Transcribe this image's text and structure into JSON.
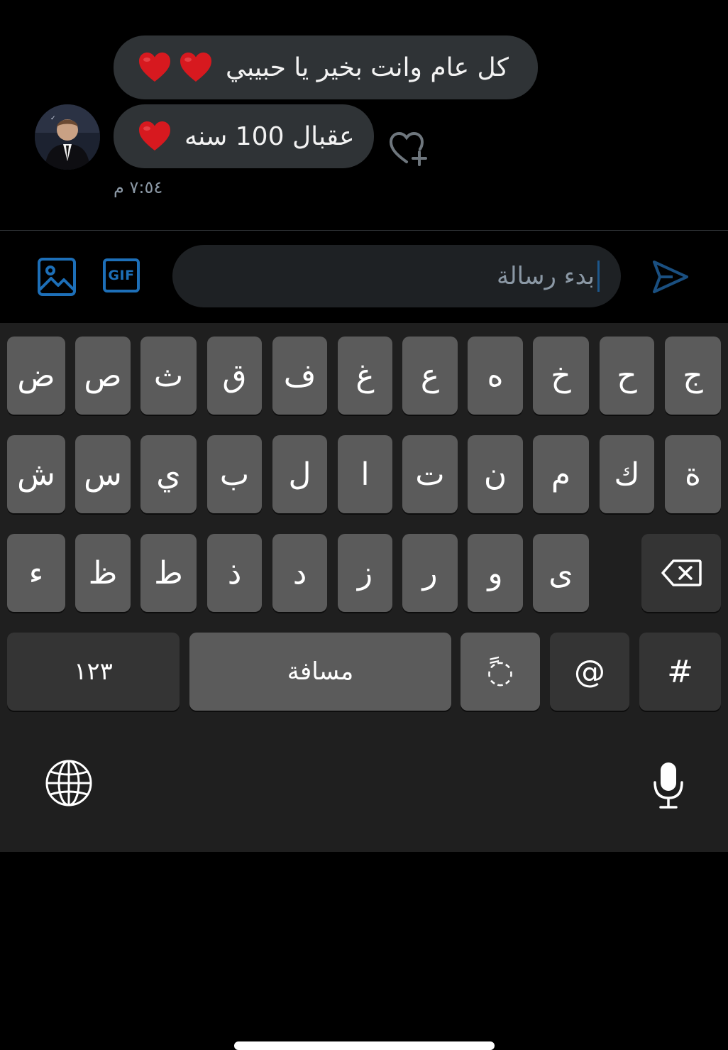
{
  "conversation": {
    "messages": [
      {
        "text": "كل عام وانت بخير يا حبيبي",
        "emoji": [
          "❤️",
          "❤️"
        ]
      },
      {
        "text": "عقبال 100 سنه",
        "emoji": [
          "❤️"
        ]
      }
    ],
    "timestamp": "٧:٥٤ م",
    "react_icon": "heart-plus-icon",
    "avatar": "avatar"
  },
  "composer": {
    "placeholder": "بدء رسالة",
    "image_icon": "image-icon",
    "gif_label": "GIF",
    "send_icon": "send-icon",
    "accent": "#1d6fb8"
  },
  "keyboard": {
    "row1": [
      "ض",
      "ص",
      "ث",
      "ق",
      "ف",
      "غ",
      "ع",
      "ه",
      "خ",
      "ح",
      "ج"
    ],
    "row2": [
      "ش",
      "س",
      "ي",
      "ب",
      "ل",
      "ا",
      "ت",
      "ن",
      "م",
      "ك",
      "ة"
    ],
    "row3": [
      "ء",
      "ظ",
      "ط",
      "ذ",
      "د",
      "ز",
      "ر",
      "و",
      "ى"
    ],
    "backspace_icon": "backspace-icon",
    "numbers_label": "١٢٣",
    "space_label": "مسافة",
    "tanween_label": "◌ً",
    "at_label": "@",
    "hash_label": "#",
    "globe_icon": "globe-icon",
    "mic_icon": "microphone-icon"
  }
}
